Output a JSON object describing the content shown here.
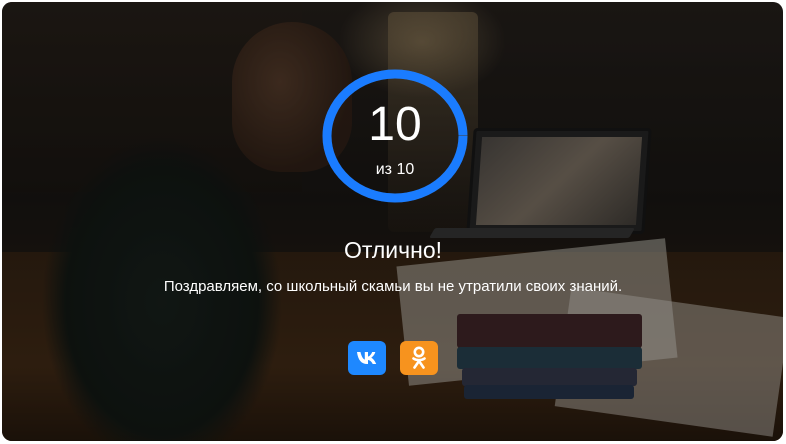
{
  "result": {
    "score": "10",
    "total": "из 10",
    "fraction": 1.0,
    "title": "Отлично!",
    "message": "Поздравляем, со школьный скамьи вы не утратили своих знаний."
  },
  "share": {
    "buttons": [
      {
        "network": "VK",
        "icon": "vk-icon",
        "color": "#1e88ff"
      },
      {
        "network": "Odnoklassniki",
        "icon": "ok-icon",
        "color": "#f7931e"
      }
    ]
  },
  "colors": {
    "ring": "#1a7cff",
    "text": "#ffffff"
  }
}
